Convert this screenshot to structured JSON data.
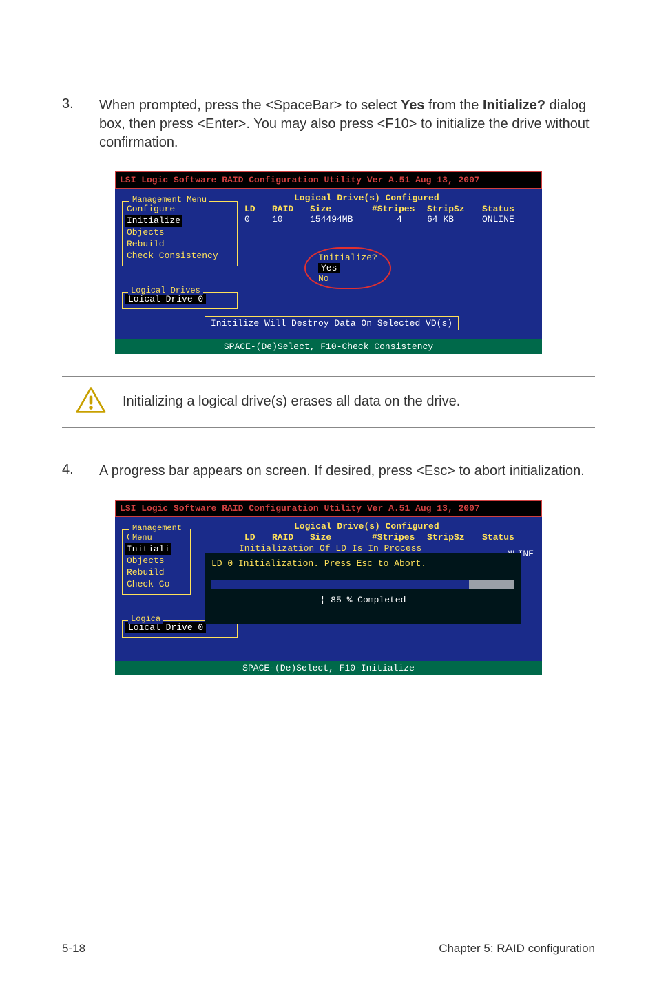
{
  "step3": {
    "num": "3.",
    "text_before": "When prompted, press the <SpaceBar> to select ",
    "bold1": "Yes",
    "text_mid": " from the ",
    "bold2": "Initialize?",
    "text_after": " dialog box, then press <Enter>. You may also press <F10> to initialize the drive without confirmation."
  },
  "term1": {
    "title": "LSI Logic Software RAID Configuration Utility Ver A.51 Aug 13, 2007",
    "config_label": "Logical Drive(s) Configured",
    "cols": {
      "ld": "LD",
      "raid": "RAID",
      "size": "Size",
      "stripes": "#Stripes",
      "stripsz": "StripSz",
      "status": "Status"
    },
    "row": {
      "ld": "0",
      "raid": "10",
      "size": "154494MB",
      "stripes": "4",
      "stripsz": "64 KB",
      "status": "ONLINE"
    },
    "mgmt_title": "Management Menu",
    "mgmt": {
      "configure": "Configure",
      "initialize": "Initialize",
      "objects": "Objects",
      "rebuild": "Rebuild",
      "check": "Check Consistency"
    },
    "ld_title": "Logical Drives",
    "ld_item": "Loical Drive 0",
    "dlg_title": "Initialize?",
    "dlg_yes": "Yes",
    "dlg_no": "No",
    "destroy": "Initilize Will Destroy Data On Selected VD(s)",
    "footer": "SPACE-(De)Select, F10-Check Consistency"
  },
  "note": "Initializing a logical drive(s) erases all data on the drive.",
  "step4": {
    "num": "4.",
    "text": "A progress bar appears on screen. If desired, press <Esc> to abort initialization."
  },
  "term2": {
    "title": "LSI Logic Software RAID Configuration Utility Ver A.51 Aug 13, 2007",
    "config_label": "Logical Drive(s) Configured",
    "cols": {
      "ld": "LD",
      "raid": "RAID",
      "size": "Size",
      "stripes": "#Stripes",
      "stripsz": "StripSz",
      "status": "Status"
    },
    "status_trunc": "NLINE",
    "mgmt_title": "Management Menu",
    "mgmt": {
      "configure": "Configure",
      "initialize": "Initiali",
      "objects": "Objects",
      "rebuild": "Rebuild",
      "check": "Check Co"
    },
    "ld_title": "Logica",
    "ld_item": "Loical Drive 0",
    "init_line": "Initialization Of LD Is In Process",
    "progress_msg": "LD 0 Initialization. Press Esc to Abort.",
    "progress_pct": "¦ 85 % Completed",
    "footer": "SPACE-(De)Select, F10-Initialize"
  },
  "footer": {
    "left": "5-18",
    "right": "Chapter 5: RAID configuration"
  }
}
